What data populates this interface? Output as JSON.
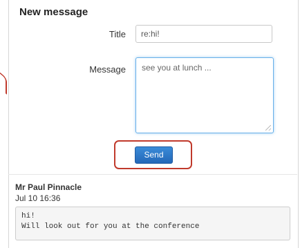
{
  "form": {
    "heading": "New message",
    "title_label": "Title",
    "title_value": "re:hi!",
    "message_label": "Message",
    "message_value": "see you at lunch ...",
    "send_label": "Send"
  },
  "thread": {
    "author": "Mr Paul Pinnacle",
    "timestamp": "Jul 10 16:36",
    "subject": "hi!",
    "body": "Will look out for you at the conference"
  },
  "colors": {
    "highlight": "#c0392b",
    "button": "#2468b8"
  }
}
